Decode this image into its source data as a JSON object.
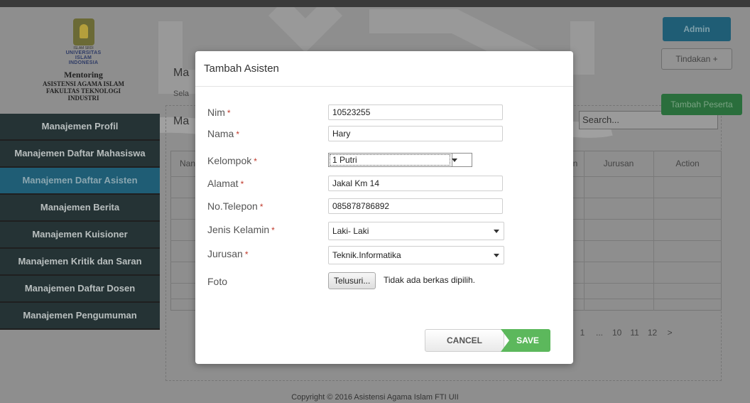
{
  "logo": {
    "small": "ISLAM SRDI",
    "university_line1": "UNIVERSITAS",
    "university_line2": "ISLAM",
    "university_line3": "INDONESIA",
    "app_name": "Mentoring",
    "line1": "ASISTENSI AGAMA ISLAM",
    "line2": "FAKULTAS TEKNOLOGI",
    "line3": "INDUSTRI"
  },
  "sidebar": {
    "items": [
      {
        "label": "Manajemen Profil"
      },
      {
        "label": "Manajemen Daftar Mahasiswa"
      },
      {
        "label": "Manajemen Daftar Asisten",
        "active": true
      },
      {
        "label": "Manajemen Berita"
      },
      {
        "label": "Manajemen Kuisioner"
      },
      {
        "label": "Manajemen Kritik dan Saran"
      },
      {
        "label": "Manajemen Daftar Dosen"
      },
      {
        "label": "Manajemen Pengumuman"
      }
    ]
  },
  "header": {
    "admin_label": "Admin",
    "tindakan_label": "Tindakan +",
    "tambah_peserta_label": "Tambah Peserta"
  },
  "main": {
    "title_partial": "Ma",
    "subtitle_partial": "Sela",
    "panel_title_partial": "Ma",
    "search_placeholder": "Search...",
    "columns": {
      "nama_partial": "Nan",
      "partial_n": "n",
      "jurusan": "Jurusan",
      "action": "Action"
    },
    "pagination": [
      "1",
      "...",
      "10",
      "11",
      "12",
      ">"
    ]
  },
  "modal": {
    "title": "Tambah Asisten",
    "required_mark": "*",
    "fields": {
      "nim": {
        "label": "Nim",
        "value": "10523255"
      },
      "nama": {
        "label": "Nama",
        "value": "Hary"
      },
      "kelompok": {
        "label": "Kelompok",
        "value": "1 Putri"
      },
      "alamat": {
        "label": "Alamat",
        "value": "Jakal Km 14"
      },
      "telepon": {
        "label": "No.Telepon",
        "value": "085878786892"
      },
      "jenis_kelamin": {
        "label": "Jenis Kelamin",
        "value": "Laki- Laki"
      },
      "jurusan": {
        "label": "Jurusan",
        "value": "Teknik.Informatika"
      },
      "foto": {
        "label": "Foto",
        "button": "Telusuri...",
        "status": "Tidak ada berkas dipilih."
      }
    },
    "cancel_label": "CANCEL",
    "save_label": "SAVE"
  },
  "footer": {
    "text": "Copyright © 2016 Asistensi Agama Islam FTI UII"
  },
  "colors": {
    "sidebar_bg": "#253335",
    "sidebar_active": "#1f5d75",
    "save_green": "#5cb85c",
    "required_red": "#c0392b"
  }
}
